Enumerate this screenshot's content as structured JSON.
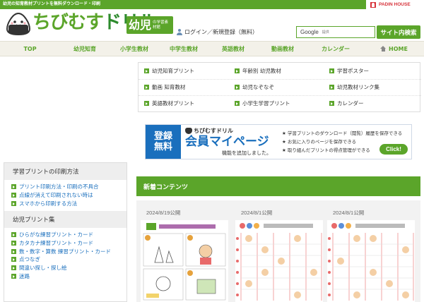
{
  "topbar": {
    "text": "幼児の知育教材プリントを無料ダウンロード・印刷",
    "brand": "PADIN HOUSE"
  },
  "header": {
    "logo_hiragana": "ちびむす",
    "logo_katakana": "ドリル",
    "badge_main": "幼児",
    "badge_sub": "の学習素材館",
    "login_text": "ログイン／新規登録（無料）",
    "search_placeholder_brand": "Google",
    "search_hint": "提供",
    "search_button": "サイト内検索"
  },
  "nav": {
    "items": [
      {
        "label": "TOP"
      },
      {
        "label": "幼児知育"
      },
      {
        "label": "小学生教材"
      },
      {
        "label": "中学生教材"
      },
      {
        "label": "英語教材"
      },
      {
        "label": "動画教材"
      },
      {
        "label": "カレンダー"
      },
      {
        "label": "HOME"
      }
    ]
  },
  "categories": [
    {
      "label": "幼児知育プリント"
    },
    {
      "label": "年齢別 幼児教材"
    },
    {
      "label": "学習ポスター"
    },
    {
      "label": "動画 知育教材"
    },
    {
      "label": "幼児なぞなぞ"
    },
    {
      "label": "幼児教材リンク集"
    },
    {
      "label": "英語教材プリント"
    },
    {
      "label": "小学生学習プリント"
    },
    {
      "label": "カレンダー"
    }
  ],
  "banner": {
    "left_top": "登録",
    "left_bottom": "無料",
    "brand": "ちびむすドリル",
    "title": "会員マイページ",
    "subtitle": "機能を追加しました。",
    "lines": [
      "★ 学習プリントのダウンロード（閲覧）履歴を保存できる",
      "★ お気に入りのページを保存できる",
      "★ 取り組んだプリントの得点管理ができる"
    ],
    "button": "Click!"
  },
  "sidebar": {
    "section1_title": "学習プリントの印刷方法",
    "section1_items": [
      {
        "label": "プリント印刷方法・印刷の不具合"
      },
      {
        "label": "点線が消えて印刷されない時は"
      },
      {
        "label": "スマホから印刷する方法"
      }
    ],
    "section2_title": "幼児プリント集",
    "section2_items": [
      {
        "label": "ひらがな練習プリント・カード"
      },
      {
        "label": "カタカナ練習プリント・カード"
      },
      {
        "label": "数・数字・算数 練習プリント・カード"
      },
      {
        "label": "点つなぎ"
      },
      {
        "label": "間違い探し・探し絵"
      },
      {
        "label": "迷路"
      }
    ]
  },
  "new_content": {
    "title": "新着コンテンツ",
    "cards": [
      {
        "date": "2024/8/19公開"
      },
      {
        "date": "2024/8/1公開"
      },
      {
        "date": "2024/8/1公開"
      }
    ]
  },
  "colors": {
    "brand_green": "#5ba52a",
    "brand_blue": "#1a6fbd",
    "padin_red": "#d7323a"
  }
}
